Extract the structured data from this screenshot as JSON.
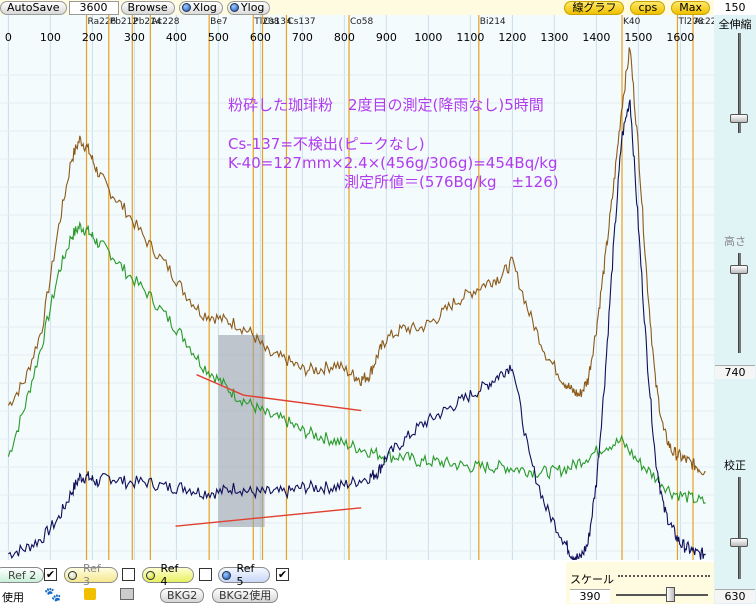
{
  "toolbar": {
    "autosave_label": "AutoSave",
    "interval_value": "3600",
    "browse_label": "Browse",
    "xlog_label": "Xlog",
    "ylog_label": "Ylog",
    "line_graph_label": "線グラフ",
    "cps_label": "cps",
    "max_label": "Max",
    "zoom_value": "150"
  },
  "right_panel": {
    "zoom_all_label": "全伸縮",
    "height_label": "高さ",
    "height_value": "740",
    "calib_label": "校正",
    "calib_value": "630"
  },
  "bottom": {
    "refs": [
      {
        "label": "Ref 2",
        "checked": true
      },
      {
        "label": "Ref 3",
        "checked": false
      },
      {
        "label": "Ref 4",
        "checked": false
      },
      {
        "label": "Ref 5",
        "checked": true
      }
    ],
    "use_label": "使用",
    "bkg2_label": "BKG2",
    "bkg2_use_label": "BKG2使用",
    "scale_label": "スケール",
    "scale_value": "390"
  },
  "annotation": {
    "line1": "粉砕した珈琲粉　2度目の測定(降雨なし)5時間",
    "line2": "Cs-137=不検出(ピークなし)",
    "line3": "K-40=127mm×2.4×(456g/306g)=454Bq/kg",
    "line4": "測定所値＝(576Bq/kg　±126)"
  },
  "colors": {
    "brown": "#8b5a1a",
    "green": "#2a9a2a",
    "navy": "#10105a",
    "red": "#e04030",
    "orange_marker": "#e8a020",
    "annotation": "#b03cf0"
  },
  "chart_data": {
    "type": "line",
    "x_unit": "keV",
    "xlim": [
      -20,
      1680
    ],
    "x_ticks": [
      0,
      100,
      200,
      300,
      400,
      500,
      600,
      700,
      800,
      900,
      1000,
      1100,
      1200,
      1300,
      1400,
      1500,
      1600
    ],
    "grid": true,
    "isotope_markers": [
      {
        "label": "Ra226",
        "x": 186
      },
      {
        "label": "Pb212",
        "x": 239
      },
      {
        "label": "Pb214",
        "x": 295
      },
      {
        "label": "Ac228",
        "x": 338
      },
      {
        "label": "Be7",
        "x": 478
      },
      {
        "label": "Tl208",
        "x": 583
      },
      {
        "label": "Cs134",
        "x": 605
      },
      {
        "label": "Cs137",
        "x": 662
      },
      {
        "label": "Co58",
        "x": 811
      },
      {
        "label": "Bi214",
        "x": 1120
      },
      {
        "label": "K40",
        "x": 1461
      },
      {
        "label": "Tl208",
        "x": 1593
      },
      {
        "label": "Ac228",
        "x": 1630
      }
    ],
    "series": [
      {
        "color": "brown",
        "x": [
          0,
          40,
          80,
          120,
          150,
          170,
          190,
          210,
          240,
          280,
          330,
          380,
          420,
          460,
          500,
          540,
          580,
          620,
          660,
          700,
          740,
          780,
          820,
          840,
          860,
          880,
          900,
          940,
          980,
          1020,
          1060,
          1100,
          1140,
          1170,
          1200,
          1240,
          1280,
          1320,
          1340,
          1360,
          1380,
          1400,
          1420,
          1440,
          1460,
          1480,
          1500,
          1520,
          1540,
          1560,
          1580,
          1600,
          1620,
          1640,
          1660
        ],
        "y": [
          0.3,
          0.35,
          0.45,
          0.65,
          0.78,
          0.82,
          0.8,
          0.76,
          0.72,
          0.68,
          0.62,
          0.57,
          0.52,
          0.48,
          0.47,
          0.46,
          0.44,
          0.4,
          0.39,
          0.37,
          0.37,
          0.38,
          0.36,
          0.35,
          0.36,
          0.4,
          0.43,
          0.45,
          0.45,
          0.47,
          0.5,
          0.52,
          0.54,
          0.55,
          0.58,
          0.48,
          0.4,
          0.35,
          0.33,
          0.32,
          0.35,
          0.45,
          0.58,
          0.72,
          0.88,
          1.0,
          0.8,
          0.55,
          0.35,
          0.25,
          0.21,
          0.2,
          0.19,
          0.18,
          0.17
        ]
      },
      {
        "color": "green",
        "x": [
          0,
          40,
          80,
          120,
          150,
          170,
          190,
          210,
          240,
          280,
          330,
          380,
          420,
          460,
          500,
          540,
          580,
          620,
          660,
          700,
          740,
          780,
          820,
          860,
          900,
          940,
          980,
          1020,
          1060,
          1100,
          1140,
          1180,
          1220,
          1260,
          1300,
          1340,
          1380,
          1420,
          1460,
          1500,
          1540,
          1580,
          1620,
          1660
        ],
        "y": [
          0.2,
          0.3,
          0.42,
          0.56,
          0.63,
          0.65,
          0.64,
          0.62,
          0.6,
          0.56,
          0.52,
          0.47,
          0.43,
          0.38,
          0.35,
          0.32,
          0.3,
          0.28,
          0.27,
          0.25,
          0.24,
          0.23,
          0.22,
          0.21,
          0.2,
          0.2,
          0.19,
          0.19,
          0.185,
          0.18,
          0.18,
          0.18,
          0.175,
          0.17,
          0.17,
          0.18,
          0.2,
          0.22,
          0.23,
          0.19,
          0.16,
          0.13,
          0.12,
          0.11
        ]
      },
      {
        "color": "navy",
        "x": [
          0,
          40,
          80,
          120,
          150,
          170,
          190,
          210,
          240,
          280,
          330,
          380,
          420,
          460,
          500,
          540,
          580,
          620,
          660,
          700,
          740,
          780,
          820,
          860,
          880,
          900,
          940,
          980,
          1020,
          1060,
          1100,
          1140,
          1170,
          1200,
          1240,
          1280,
          1320,
          1340,
          1360,
          1380,
          1400,
          1420,
          1440,
          1460,
          1480,
          1500,
          1520,
          1540,
          1560,
          1580,
          1600,
          1620,
          1640,
          1660
        ],
        "y": [
          0.01,
          0.02,
          0.04,
          0.08,
          0.13,
          0.16,
          0.16,
          0.15,
          0.16,
          0.15,
          0.15,
          0.14,
          0.14,
          0.13,
          0.13,
          0.14,
          0.13,
          0.13,
          0.13,
          0.14,
          0.14,
          0.14,
          0.15,
          0.16,
          0.17,
          0.2,
          0.23,
          0.26,
          0.28,
          0.3,
          0.32,
          0.34,
          0.36,
          0.38,
          0.2,
          0.1,
          0.04,
          0.01,
          0.0,
          0.03,
          0.15,
          0.35,
          0.6,
          0.82,
          0.9,
          0.65,
          0.4,
          0.2,
          0.1,
          0.06,
          0.03,
          0.02,
          0.01,
          0.01
        ]
      }
    ]
  }
}
